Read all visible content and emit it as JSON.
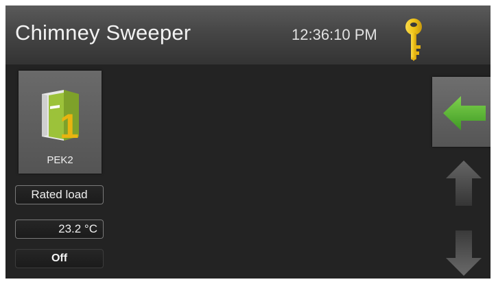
{
  "header": {
    "title": "Chimney Sweeper",
    "time": "12:36:10 PM",
    "key_icon": "key-icon",
    "key_color": "#f0c419"
  },
  "device": {
    "name": "PEK2",
    "icon": "boiler-icon",
    "accent_color": "#9cc23a",
    "badge_color": "#e8b410"
  },
  "status": {
    "load_label": "Rated load",
    "temperature": "23.2 °C",
    "state": "Off"
  },
  "navigation": {
    "back_icon": "arrow-left-icon",
    "back_color": "#5cb336",
    "up_icon": "arrow-up-icon",
    "down_icon": "arrow-down-icon"
  }
}
